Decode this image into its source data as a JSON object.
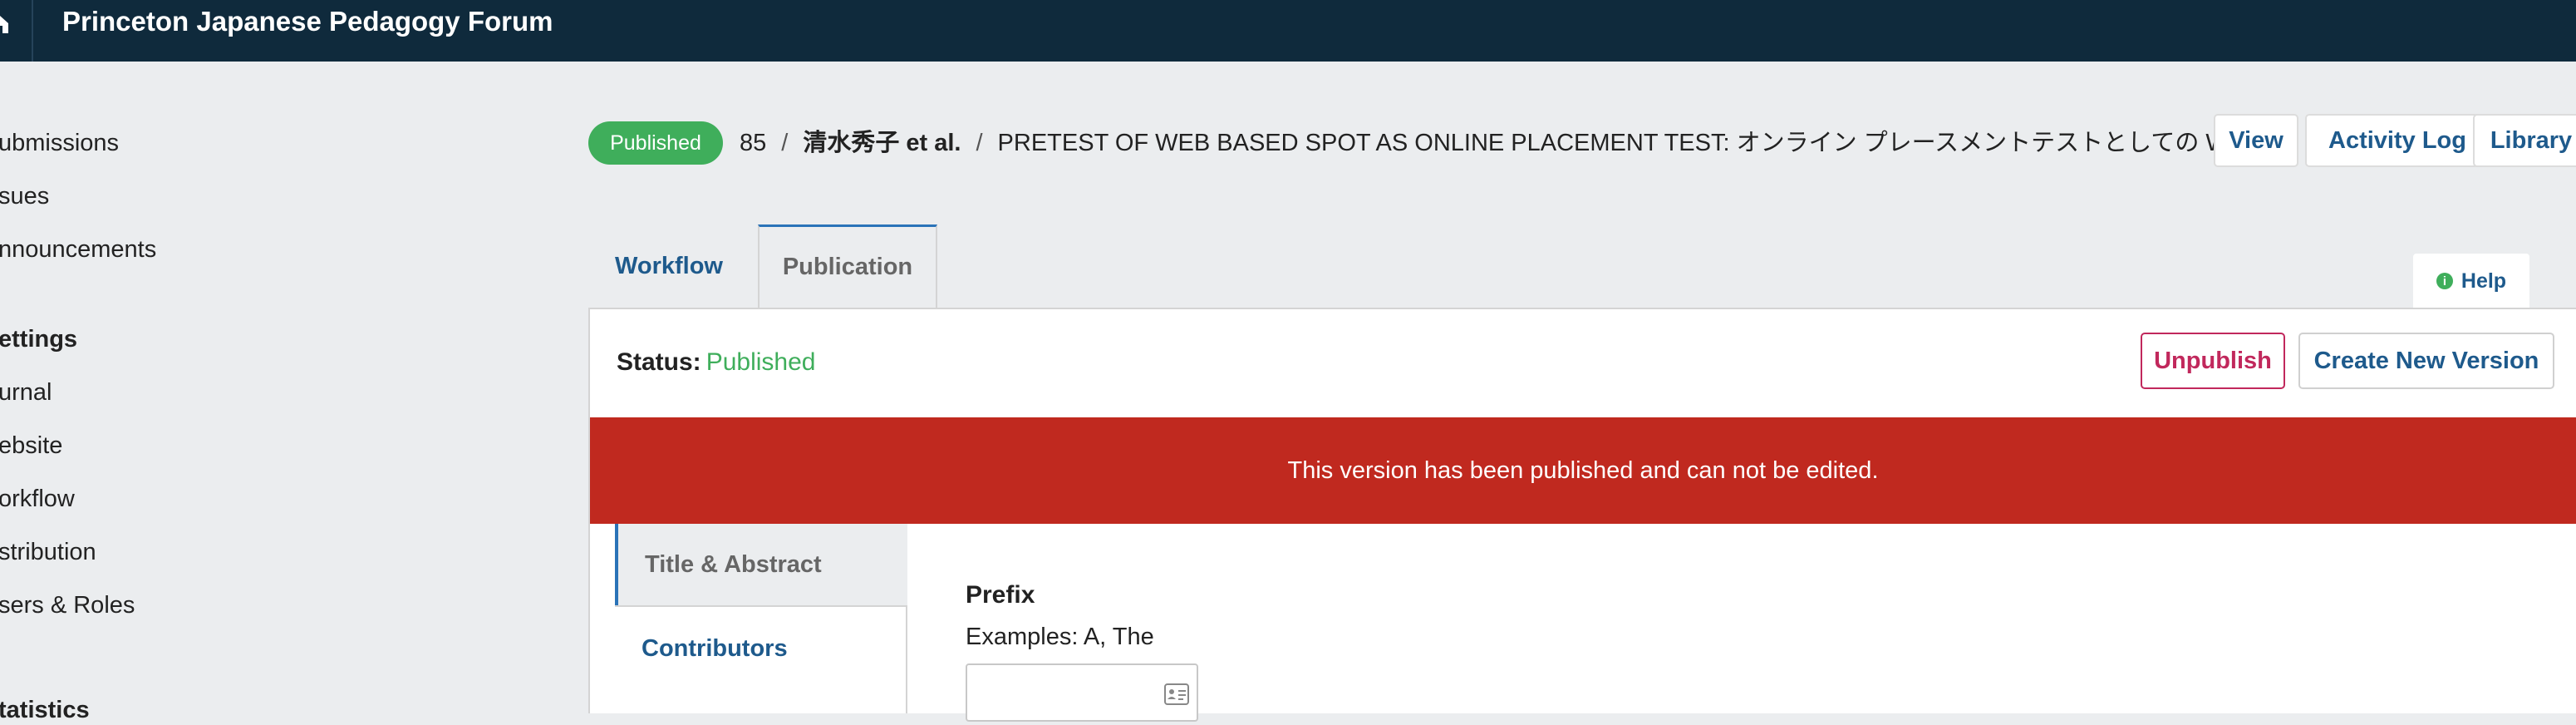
{
  "topbar": {
    "site_title": "Princeton Japanese Pedagogy Forum"
  },
  "sidebar": {
    "items": [
      {
        "label": "ubmissions"
      },
      {
        "label": "sues"
      },
      {
        "label": "nnouncements"
      }
    ],
    "settings_heading": "ettings",
    "settings_items": [
      {
        "label": "urnal"
      },
      {
        "label": "ebsite"
      },
      {
        "label": "orkflow"
      },
      {
        "label": "stribution"
      },
      {
        "label": "sers & Roles"
      }
    ],
    "statistics_heading": "tatistics"
  },
  "header": {
    "status_badge": "Published",
    "submission_id": "85",
    "separator": "/",
    "authors": "清水秀子 et al.",
    "title": "PRETEST OF WEB BASED SPOT AS ONLINE PLACEMENT TEST: オンライン プレースメントテストとしての WEB",
    "buttons": {
      "view": "View",
      "activity_log": "Activity Log",
      "library": "Library"
    }
  },
  "tabs": {
    "workflow": "Workflow",
    "publication": "Publication",
    "help": "Help",
    "help_icon_glyph": "i"
  },
  "publication": {
    "status_label": "Status:",
    "status_value": "Published",
    "unpublish_label": "Unpublish",
    "create_version_label": "Create New Version",
    "alert_text": "This version has been published and can not be edited.",
    "side_tabs": {
      "title_abstract": "Title & Abstract",
      "contributors": "Contributors"
    },
    "prefix": {
      "label": "Prefix",
      "description": "Examples: A, The",
      "value": ""
    }
  },
  "colors": {
    "topbar": "#0f2a3c",
    "published_green": "#3fae5b",
    "alert_red": "#c0291f",
    "link_blue": "#1e5a8c",
    "unpublish_pink": "#c1285c"
  },
  "icons": {
    "topbar": "home-icon",
    "help": "info-icon",
    "prefix_field": "contact-card-icon"
  }
}
